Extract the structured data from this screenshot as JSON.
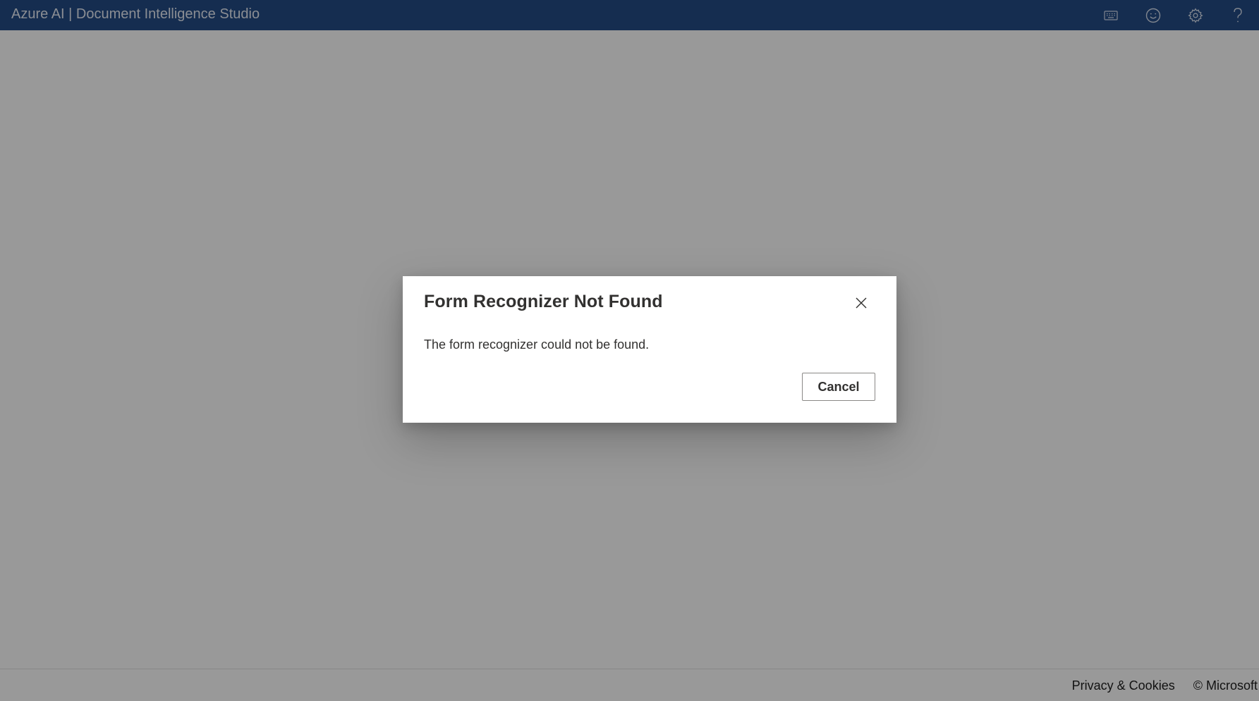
{
  "header": {
    "title": "Azure AI | Document Intelligence Studio",
    "actions": [
      {
        "name": "keyboard-shortcuts",
        "icon": "keyboard-icon"
      },
      {
        "name": "feedback",
        "icon": "smiley-icon"
      },
      {
        "name": "settings",
        "icon": "gear-icon"
      },
      {
        "name": "help",
        "icon": "question-icon"
      }
    ],
    "background_color": "#234b86"
  },
  "dialog": {
    "title": "Form Recognizer Not Found",
    "message": "The form recognizer could not be found.",
    "cancel_label": "Cancel",
    "close_icon": "close-icon"
  },
  "footer": {
    "privacy_label": "Privacy & Cookies",
    "copyright": "© Microsoft"
  }
}
